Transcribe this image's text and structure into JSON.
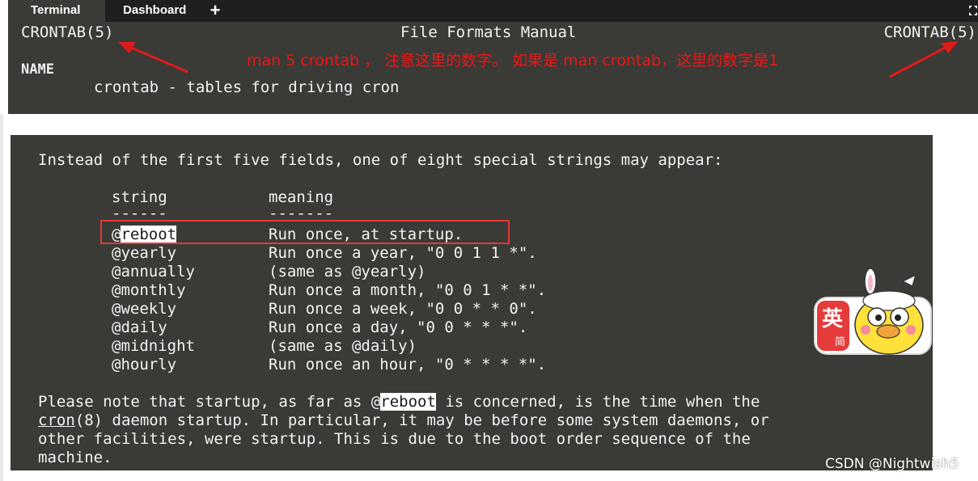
{
  "tabs": [
    {
      "label": "Terminal",
      "active": true
    },
    {
      "label": "Dashboard",
      "active": false
    }
  ],
  "add_tab_glyph": "+",
  "icons": {
    "add": "plus-icon",
    "fullscreen": "fullscreen-icon"
  },
  "man_header": {
    "left": "CRONTAB(5)",
    "center": "File Formats Manual",
    "right": "CRONTAB(5)"
  },
  "name_section": {
    "heading": "NAME",
    "line": "crontab - tables for driving cron"
  },
  "annotation": "man 5 crontab ， 注意这里的数字。 如果是 man crontab，这里的数字是1",
  "special_strings": {
    "intro": "Instead of the first five fields, one of eight special strings may appear:",
    "col_headers": [
      "string",
      "meaning"
    ],
    "col_rules": [
      "------",
      "-------"
    ],
    "rows": [
      {
        "at": "@",
        "name": "reboot",
        "meaning": "Run once, at startup.",
        "highlight": true
      },
      {
        "at": "@",
        "name": "yearly",
        "meaning": "Run once a year, \"0 0 1 1 *\"."
      },
      {
        "at": "@",
        "name": "annually",
        "meaning": "(same as @yearly)"
      },
      {
        "at": "@",
        "name": "monthly",
        "meaning": "Run once a month, \"0 0 1 * *\"."
      },
      {
        "at": "@",
        "name": "weekly",
        "meaning": "Run once a week, \"0 0 * * 0\"."
      },
      {
        "at": "@",
        "name": "daily",
        "meaning": "Run once a day, \"0 0 * * *\"."
      },
      {
        "at": "@",
        "name": "midnight",
        "meaning": "(same as @daily)"
      },
      {
        "at": "@",
        "name": "hourly",
        "meaning": "Run once an hour, \"0 * * * *\"."
      }
    ]
  },
  "note": {
    "l1_a": "Please note that startup, as far as @",
    "l1_hl": "reboot",
    "l1_b": " is concerned, is the time when the",
    "l2_link": "cron",
    "l2_b": "(8) daemon startup. In particular, it may be before some system daemons, or",
    "l3": "other facilities, were startup. This is due to the boot order sequence of the",
    "l4": "machine."
  },
  "sticker": {
    "char1": "英",
    "char2": "简"
  },
  "watermark": "CSDN @Nightwish5",
  "colors": {
    "annotation": "#f01414",
    "terminal_bg": "#3a3a36",
    "terminal_fg": "#f2f2f2"
  }
}
